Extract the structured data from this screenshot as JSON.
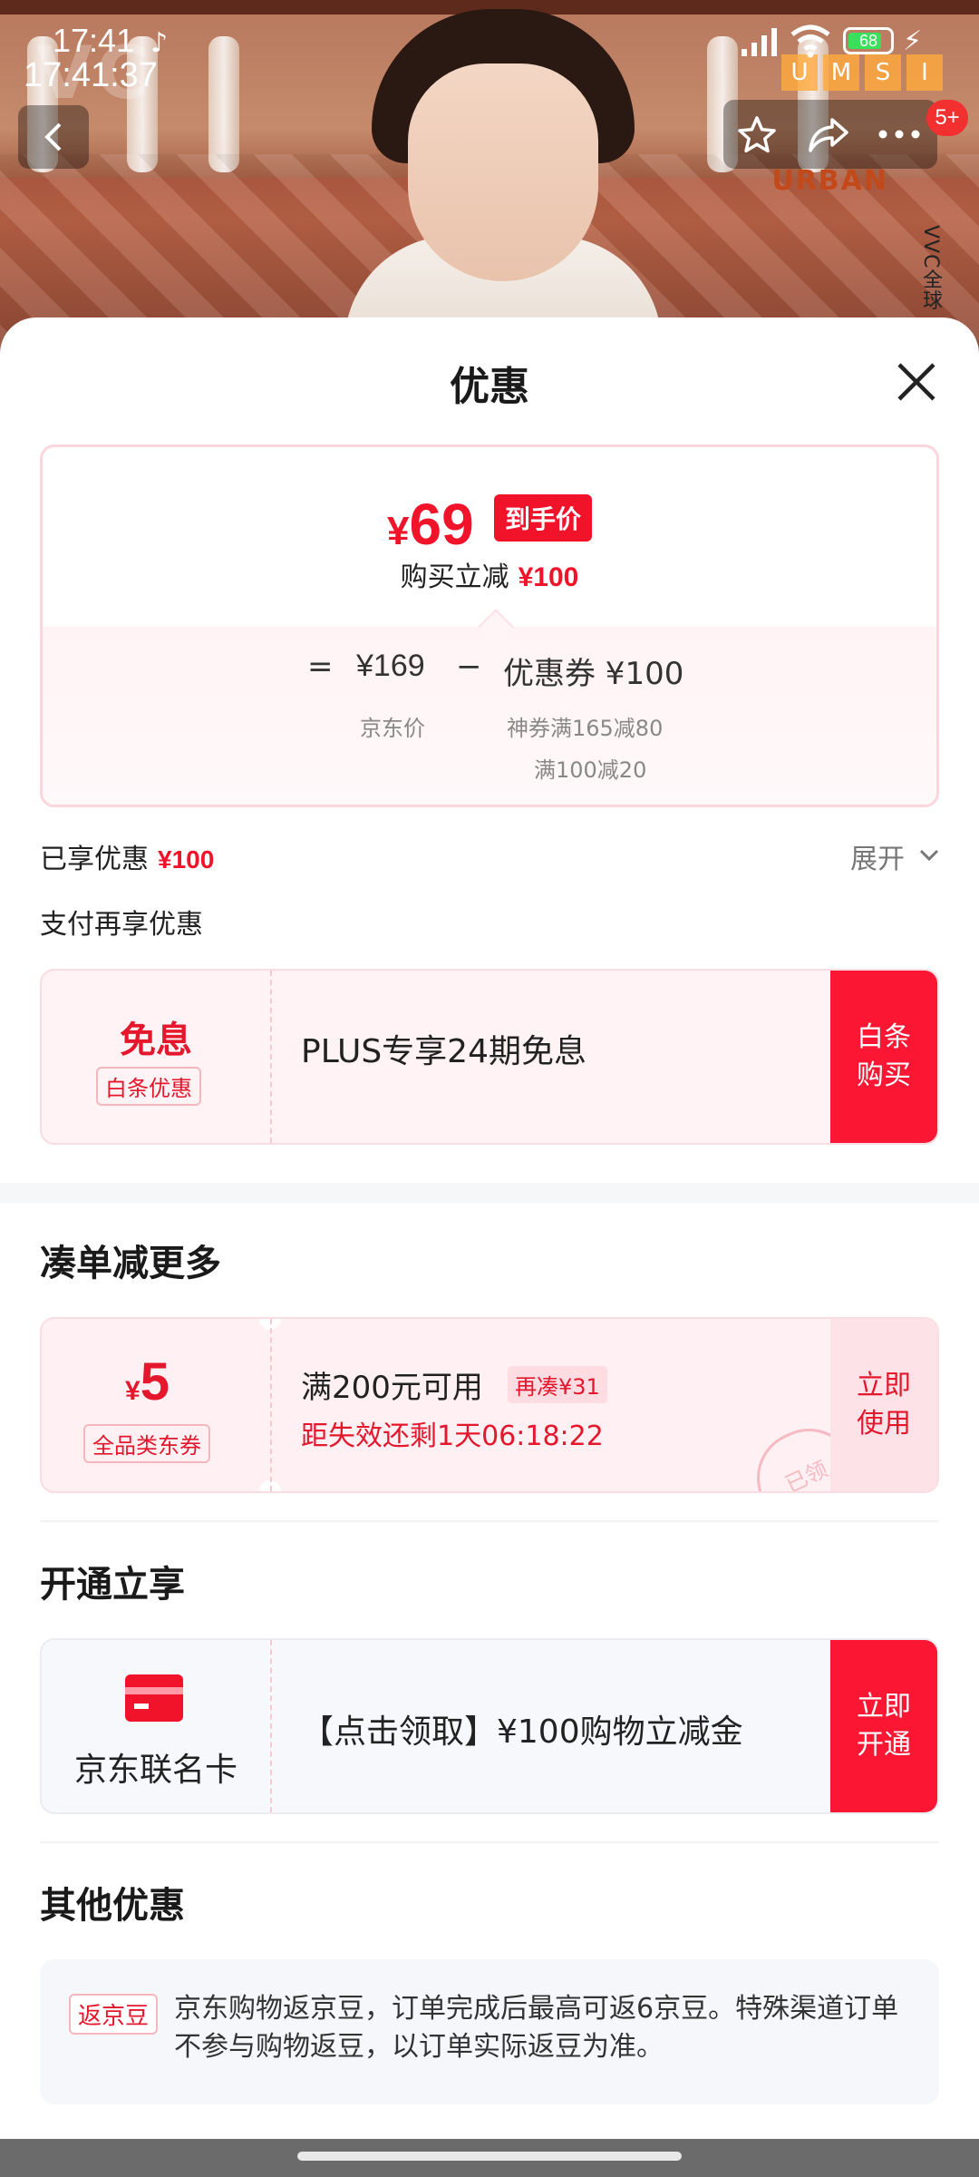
{
  "status_bar": {
    "time": "17:41",
    "clock": "17:41:37",
    "battery": "68"
  },
  "hero": {
    "brand_text": "VC",
    "side_text": "VVC全球",
    "umsi_letters": [
      "U",
      "M",
      "S",
      "I"
    ],
    "urban_text": "URBAN",
    "cart_badge": "5+"
  },
  "sheet": {
    "title": "优惠"
  },
  "price_card": {
    "currency": "¥",
    "final_price": "69",
    "hand_price_tag": "到手价",
    "buy_reduce_label": "购买立减",
    "buy_reduce_amount": "¥100",
    "equals": "=",
    "jd_price": "¥169",
    "jd_price_label": "京东价",
    "minus": "−",
    "coupon_label": "优惠券 ¥100",
    "coupon_detail_1": "神券满165减80",
    "coupon_detail_2": "满100减20"
  },
  "enjoyed": {
    "label": "已享优惠",
    "amount": "¥100",
    "expand": "展开"
  },
  "pay_again": {
    "title": "支付再享优惠",
    "left_title": "免息",
    "left_tag": "白条优惠",
    "text": "PLUS专享24期免息",
    "button": "白条购买"
  },
  "bundle": {
    "title": "凑单减更多",
    "currency": "¥",
    "amount": "5",
    "tag": "全品类东券",
    "condition": "满200元可用",
    "again_tag": "再凑¥31",
    "countdown": "距失效还剩1天06:18:22",
    "button": "立即使用",
    "stamp": "已领"
  },
  "open_enjoy": {
    "title": "开通立享",
    "card_name": "京东联名卡",
    "text": "【点击领取】¥100购物立减金",
    "button": "立即开通"
  },
  "other": {
    "title": "其他优惠",
    "tag": "返京豆",
    "text": "京东购物返京豆，订单完成后最高可返6京豆。特殊渠道订单不参与购物返豆，以订单实际返豆为准。"
  },
  "colors": {
    "accent_red": "#f0132a",
    "button_red": "#fb1734"
  }
}
